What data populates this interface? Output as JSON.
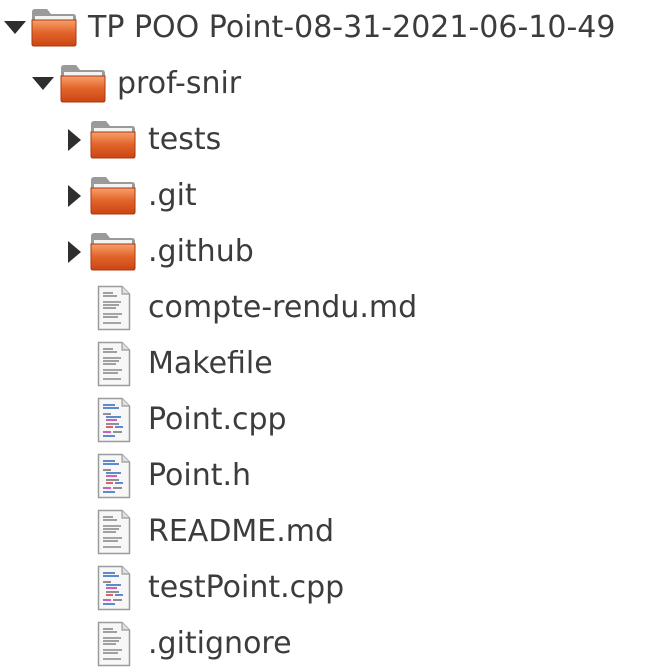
{
  "tree": {
    "root": {
      "label": "TP POO Point-08-31-2021-06-10-49",
      "icon": "folder-icon",
      "expanded": true
    },
    "prof_snir": {
      "label": "prof-snir",
      "icon": "folder-icon",
      "expanded": true
    },
    "folders": [
      {
        "label": "tests",
        "icon": "folder-icon",
        "expanded": false
      },
      {
        "label": ".git",
        "icon": "folder-icon",
        "expanded": false
      },
      {
        "label": ".github",
        "icon": "folder-icon",
        "expanded": false
      }
    ],
    "files": [
      {
        "label": "compte-rendu.md",
        "icon": "text-file-icon"
      },
      {
        "label": "Makefile",
        "icon": "text-file-icon"
      },
      {
        "label": "Point.cpp",
        "icon": "source-file-icon"
      },
      {
        "label": "Point.h",
        "icon": "source-file-icon"
      },
      {
        "label": "README.md",
        "icon": "text-file-icon"
      },
      {
        "label": "testPoint.cpp",
        "icon": "source-file-icon"
      },
      {
        "label": ".gitignore",
        "icon": "text-file-icon"
      }
    ]
  }
}
